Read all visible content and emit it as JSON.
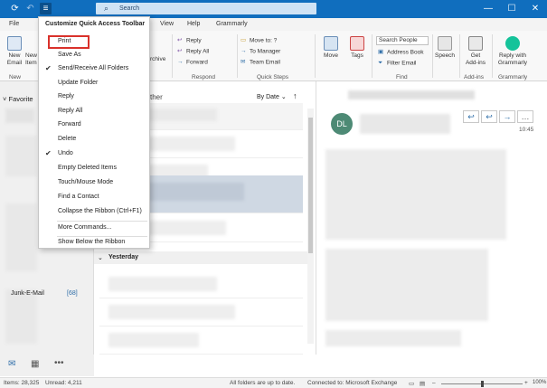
{
  "titlebar": {
    "search_label": "Search",
    "minimize": "—",
    "maximize": "☐",
    "close": "✕"
  },
  "menubar": {
    "tabs": [
      "File",
      "View",
      "Help",
      "Grammarly"
    ]
  },
  "ribbon": {
    "new_email": [
      "New",
      "Email"
    ],
    "new_items": [
      "New",
      "Item"
    ],
    "archive": "rchive",
    "respond": {
      "reply": "Reply",
      "reply_all": "Reply All",
      "forward": "Forward",
      "group": "Respond"
    },
    "quick_steps": {
      "move_to": "Move to: ?",
      "to_manager": "To Manager",
      "team_email": "Team Email",
      "group": "Quick Steps"
    },
    "move": "Move",
    "tags": "Tags",
    "find": {
      "search_people": "Search People",
      "address_book": "Address Book",
      "filter_email": "Filter Email",
      "group": "Find"
    },
    "speech": "Speech",
    "addins": {
      "label": [
        "Get",
        "Add-ins"
      ],
      "group": "Add-ins"
    },
    "grammarly": {
      "label": [
        "Reply with",
        "Grammarly"
      ],
      "group": "Grammarly"
    },
    "new_group": "New"
  },
  "sidebar": {
    "favorites": "Favorite",
    "junk_label": "Junk-E-Mail",
    "junk_count": "[68]"
  },
  "message_list": {
    "header_partial": "ther",
    "sort": "By Date",
    "sort_arrow": "↑",
    "group_yesterday": "Yesterday"
  },
  "reading_pane": {
    "avatar_initials": "DL",
    "time": "10:45",
    "zoom": "100%"
  },
  "statusbar": {
    "items": "Items: 28,325",
    "unread": "Unread: 4,211",
    "sync": "All folders are up to date.",
    "connection": "Connected to: Microsoft Exchange"
  },
  "qat_menu": {
    "title": "Customize Quick Access Toolbar",
    "items": [
      {
        "label": "Print",
        "checked": false
      },
      {
        "label": "Save As",
        "checked": false
      },
      {
        "label": "Send/Receive All Folders",
        "checked": true
      },
      {
        "label": "Update Folder",
        "checked": false
      },
      {
        "label": "Reply",
        "checked": false
      },
      {
        "label": "Reply All",
        "checked": false
      },
      {
        "label": "Forward",
        "checked": false
      },
      {
        "label": "Delete",
        "checked": false
      },
      {
        "label": "Undo",
        "checked": true
      },
      {
        "label": "Empty Deleted Items",
        "checked": false
      },
      {
        "label": "Touch/Mouse Mode",
        "checked": false
      },
      {
        "label": "Find a Contact",
        "checked": false
      },
      {
        "label": "Collapse the Ribbon (Ctrl+F1)",
        "checked": false
      },
      {
        "label": "More Commands...",
        "checked": false
      },
      {
        "label": "Show Below the Ribbon",
        "checked": false
      }
    ],
    "highlight_color": "#d9322b"
  },
  "colors": {
    "titlebar": "#106ebe",
    "accent": "#2f6ea8",
    "avatar": "#4d8a75",
    "grammarly": "#15c39a"
  }
}
